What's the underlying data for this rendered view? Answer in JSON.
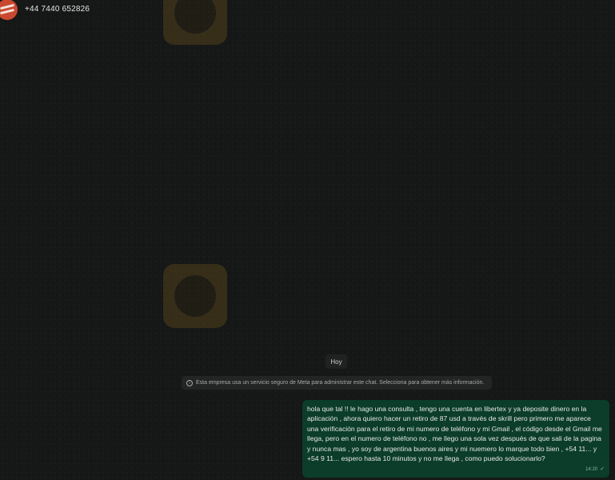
{
  "header": {
    "contact_phone": "+44 7440 652826",
    "avatar_icon": "brand-logo-icon"
  },
  "watermarks": [
    {
      "icon": "eagle-badge-icon"
    },
    {
      "icon": "eagle-badge-icon"
    }
  ],
  "chat": {
    "day_label": "Hoy",
    "system_notice": {
      "icon": "info-icon",
      "text": "Esta empresa usa un servicio seguro de Meta para administrar este chat. Selecciona para obtener más información."
    },
    "messages": [
      {
        "direction": "outgoing",
        "text": "hola que tal !! le hago una consulta , tengo una cuenta en libertex y ya deposite dinero en la aplicación , ahora quiero hacer un retiro de 87 usd a través de skrill pero primero me aparece una verificación para el retiro de mi numero de teléfono y mi Gmail , el código desde el Gmail me llega, pero en el numero de teléfono no , me llego una sola vez después de que sali de la pagina y nunca mas , yo soy de argentina buenos aires y mi nuemero lo marque todo bien , +54 11... y +54 9 11... espero hasta 10 minutos y no me llega , como puedo solucionarlo?",
        "time": "14:20",
        "status_icon": "check-icon"
      }
    ]
  },
  "colors": {
    "background": "#161717",
    "outgoing_bubble": "#0b3d2a",
    "avatar": "#c9482f"
  }
}
